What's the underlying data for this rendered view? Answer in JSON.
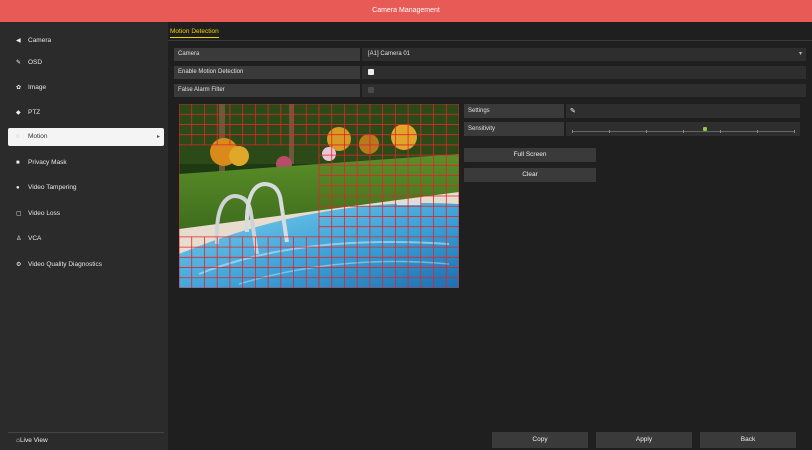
{
  "app": {
    "title": "Camera Management"
  },
  "sidebar": {
    "items": [
      {
        "label": "Camera",
        "icon": "camera-icon"
      },
      {
        "label": "OSD",
        "icon": "brush-icon"
      },
      {
        "label": "Image",
        "icon": "image-icon"
      },
      {
        "label": "PTZ",
        "icon": "ptz-icon"
      },
      {
        "label": "Motion",
        "icon": "motion-icon",
        "active": true
      },
      {
        "label": "Privacy Mask",
        "icon": "privacy-mask-icon"
      },
      {
        "label": "Video Tampering",
        "icon": "tampering-icon"
      },
      {
        "label": "Video Loss",
        "icon": "video-loss-icon"
      },
      {
        "label": "VCA",
        "icon": "vca-icon"
      },
      {
        "label": "Video Quality Diagnostics",
        "icon": "diagnostics-icon"
      }
    ],
    "live_view": "Live View"
  },
  "main": {
    "tab": "Motion Detection",
    "fields": {
      "camera_label": "Camera",
      "camera_value": "[A1] Camera 01",
      "enable_label": "Enable Motion Detection",
      "enable_checked": true,
      "false_alarm_label": "False Alarm Filter",
      "false_alarm_checked": false
    },
    "settings_label": "Settings",
    "sensitivity_label": "Sensitivity",
    "sensitivity_level": 0.6,
    "full_screen_label": "Full Screen",
    "clear_label": "Clear"
  },
  "footer": {
    "copy_label": "Copy",
    "apply_label": "Apply",
    "back_label": "Back"
  },
  "colors": {
    "titlebar": "#e85a55",
    "tab_accent": "#f0d000",
    "grid": "#e0262a",
    "slider_knob": "#8ac846"
  }
}
